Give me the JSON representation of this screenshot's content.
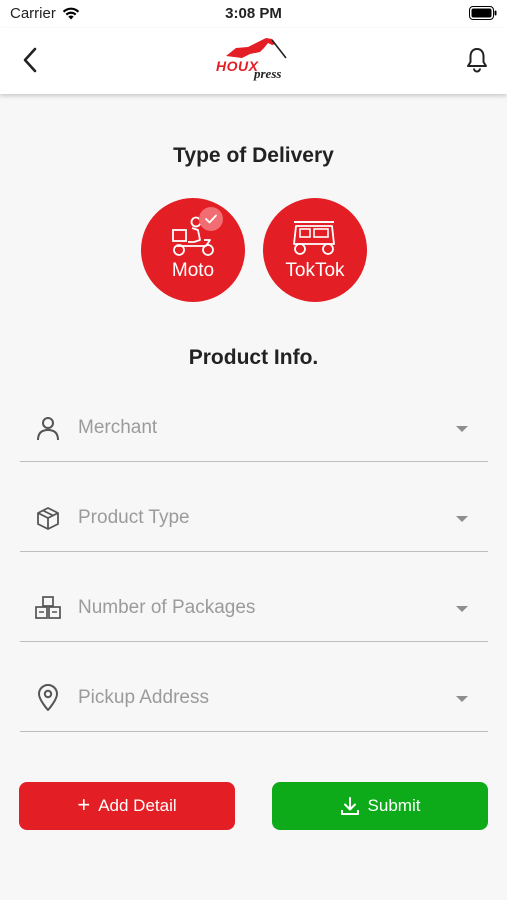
{
  "status_bar": {
    "carrier": "Carrier",
    "time": "3:08 PM"
  },
  "header": {
    "logo_main": "HOUX",
    "logo_sub": "press"
  },
  "delivery": {
    "title": "Type of Delivery",
    "options": [
      {
        "label": "Moto",
        "selected": true,
        "icon": "scooter-icon"
      },
      {
        "label": "TokTok",
        "selected": false,
        "icon": "tuktuk-icon"
      }
    ]
  },
  "product": {
    "title": "Product Info.",
    "fields": [
      {
        "label": "Merchant",
        "icon": "person-icon"
      },
      {
        "label": "Product Type",
        "icon": "box-icon"
      },
      {
        "label": "Number of Packages",
        "icon": "packages-icon"
      },
      {
        "label": "Pickup Address",
        "icon": "location-pin-icon"
      }
    ]
  },
  "actions": {
    "add_label": "Add Detail",
    "submit_label": "Submit"
  },
  "colors": {
    "brand_red": "#e31e24",
    "submit_green": "#0dab1a",
    "background": "#f7f7f7"
  }
}
